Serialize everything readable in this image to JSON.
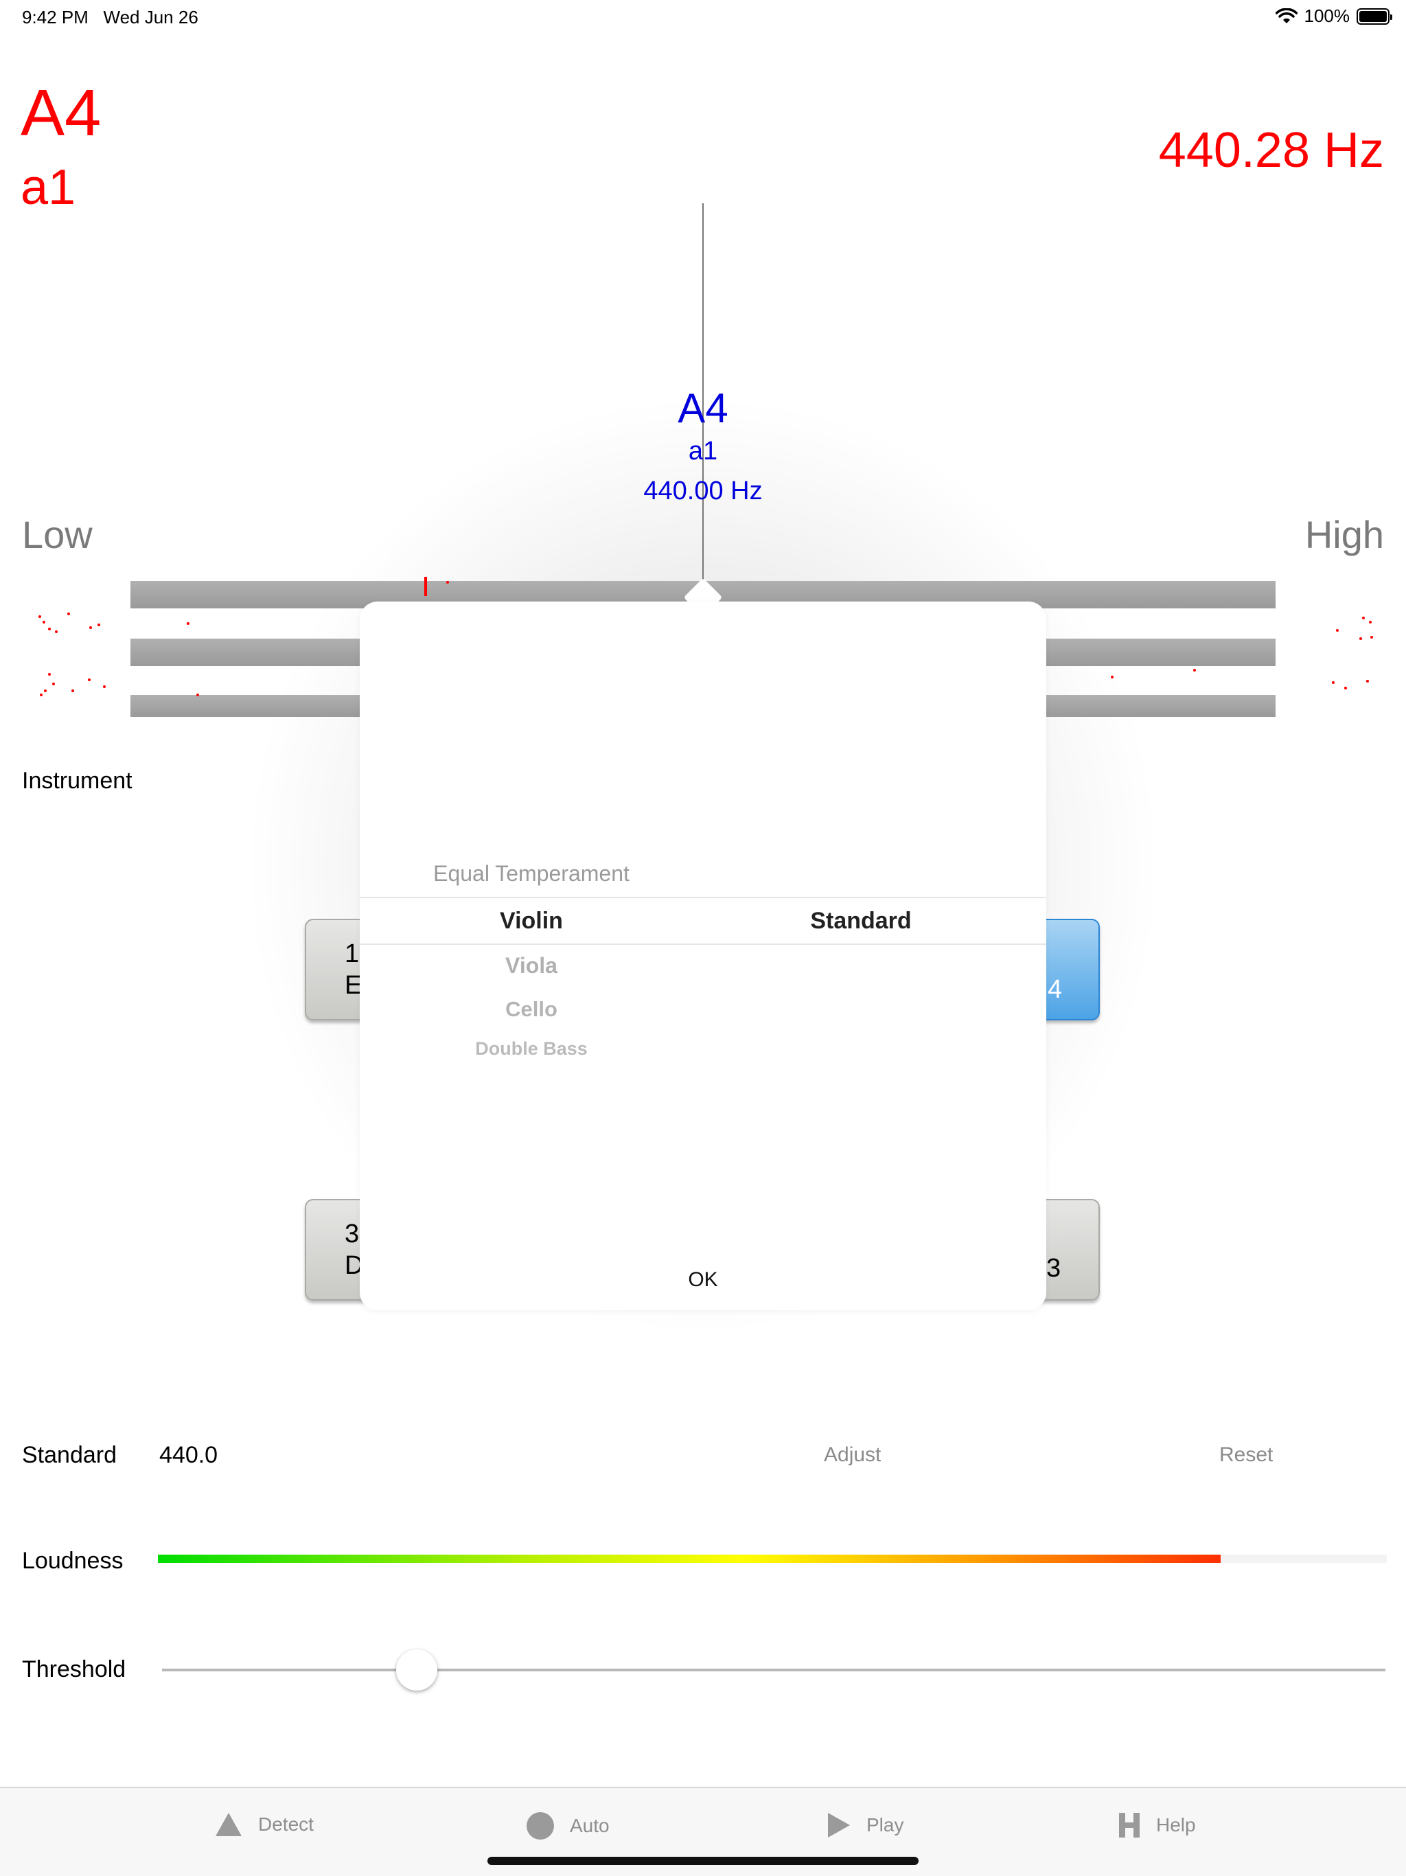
{
  "status": {
    "time": "9:42 PM",
    "date": "Wed Jun 26",
    "battery": "100%"
  },
  "detected": {
    "note": "A4",
    "helmholtz": "a1",
    "frequency": "440.28 Hz"
  },
  "target": {
    "note": "A4",
    "helmholtz": "a1",
    "frequency": "440.00 Hz"
  },
  "meter": {
    "low_label": "Low",
    "high_label": "High"
  },
  "instrument_label": "Instrument",
  "strings": [
    {
      "number": "1",
      "note": "E"
    },
    {
      "number": "4",
      "note": ""
    },
    {
      "number": "3",
      "note": "D"
    },
    {
      "number": "3",
      "note": ""
    }
  ],
  "popover": {
    "tuning_above": "Equal Temperament",
    "instrument_selected": "Violin",
    "tuning_selected": "Standard",
    "instrument_below": [
      "Viola",
      "Cello",
      "Double Bass"
    ],
    "ok_label": "OK"
  },
  "standard": {
    "label": "Standard",
    "value": "440.0",
    "adjust_label": "Adjust",
    "reset_label": "Reset"
  },
  "loudness": {
    "label": "Loudness",
    "level_percent": 86.5
  },
  "threshold": {
    "label": "Threshold",
    "value_fraction": 0.208
  },
  "tabs": [
    {
      "label": "Detect",
      "icon": "triangle-icon"
    },
    {
      "label": "Auto",
      "icon": "circle-icon"
    },
    {
      "label": "Play",
      "icon": "play-icon"
    },
    {
      "label": "Help",
      "icon": "help-h-icon"
    }
  ],
  "colors": {
    "detected": "#ff0000",
    "target": "#0000dd",
    "selected_string": "#4da3e6"
  }
}
